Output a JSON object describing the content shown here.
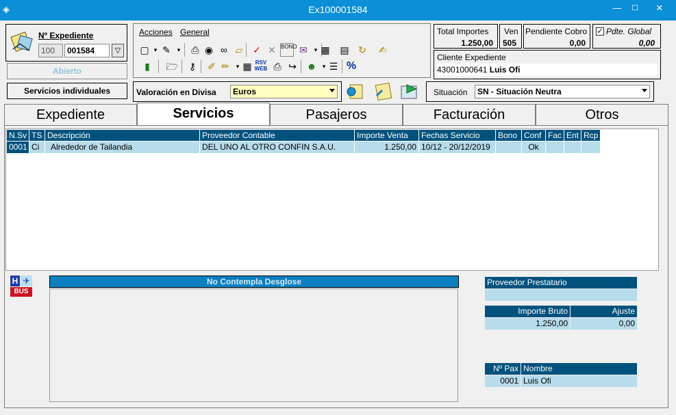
{
  "window": {
    "title": "Ex100001584",
    "minimize": "—",
    "maximize": "☐",
    "close": "✕"
  },
  "expediente": {
    "label": "Nº Expediente",
    "prefix": "100",
    "number": "001584",
    "status": "Abierto",
    "type": "Servicios individuales"
  },
  "menu": {
    "acciones": "Acciones",
    "general": "General"
  },
  "toolbar": {
    "icons_row1": [
      "new-doc-icon",
      "dropdown-icon",
      "edit-icon",
      "dropdown-icon",
      "print-icon",
      "view-icon",
      "binoculars-icon",
      "eraser-icon",
      "check-icon",
      "cross-icon",
      "bono-icon",
      "send-icon",
      "dropdown-icon",
      "calculator-icon",
      "document-icon",
      "refresh-icon",
      "notes-icon"
    ],
    "icons_row2": [
      "lift-icon",
      "open-folder-icon",
      "key-icon",
      "note-icon",
      "edit2-icon",
      "dropdown-icon",
      "table-icon",
      "rsv-web-icon",
      "printer-icon",
      "forward-icon",
      "user-icon",
      "dropdown-icon",
      "list-icon",
      "percent-icon"
    ],
    "rsv_web_label": "RSV WEB",
    "percent_label": "%"
  },
  "totals": {
    "importes_label": "Total Importes",
    "importes_value": "1.250,00",
    "ven_label": "Ven",
    "ven_value": "505",
    "pendiente_label": "Pendiente Cobro",
    "pendiente_value": "0,00",
    "pdte_global_label": "Pdte. Global",
    "pdte_global_value": "0,00"
  },
  "cliente": {
    "label": "Cliente Expediente",
    "code": "43001000641",
    "name": "Luis Ofi"
  },
  "divisa": {
    "label": "Valoración en Divisa",
    "value": "Euros"
  },
  "situacion": {
    "label": "Situación",
    "value": "SN - Situación Neutra"
  },
  "tabs": [
    "Expediente",
    "Servicios",
    "Pasajeros",
    "Facturación",
    "Otros"
  ],
  "active_tab": "Servicios",
  "grid": {
    "headers": [
      "N.Sv",
      "TS",
      "Descripción",
      "Proveedor Contable",
      "Importe Venta",
      "Fechas Servicio",
      "Bono",
      "Conf",
      "Fac",
      "Ent",
      "Rcp"
    ],
    "rows": [
      [
        "0001",
        "Ci",
        "Alrededor de Tailandia",
        "DEL UNO AL OTRO CONFIN S.A.U.",
        "1.250,00",
        "10/12 - 20/12/2019",
        "",
        "Ok",
        "",
        "",
        ""
      ]
    ]
  },
  "desglose": {
    "header": "No Contempla Desglose"
  },
  "proveedor": {
    "header": "Proveedor Prestatario",
    "value": ""
  },
  "importes": {
    "bruto_label": "Importe Bruto",
    "bruto_value": "1.250,00",
    "ajuste_label": "Ajuste",
    "ajuste_value": "0,00"
  },
  "pasajeros": {
    "headers": [
      "Nº Pax",
      "Nombre"
    ],
    "rows": [
      [
        "0001",
        "Luis Ofi"
      ]
    ]
  },
  "icons": {
    "expediente": "folder-icon",
    "service_type": "hotel-plane-bus-icon",
    "service_type_h": "H",
    "service_type_bus": "BUS"
  },
  "colors": {
    "titlebar": "#0b8fd6",
    "grid_header": "#00527d",
    "grid_row": "#b7dceb"
  }
}
